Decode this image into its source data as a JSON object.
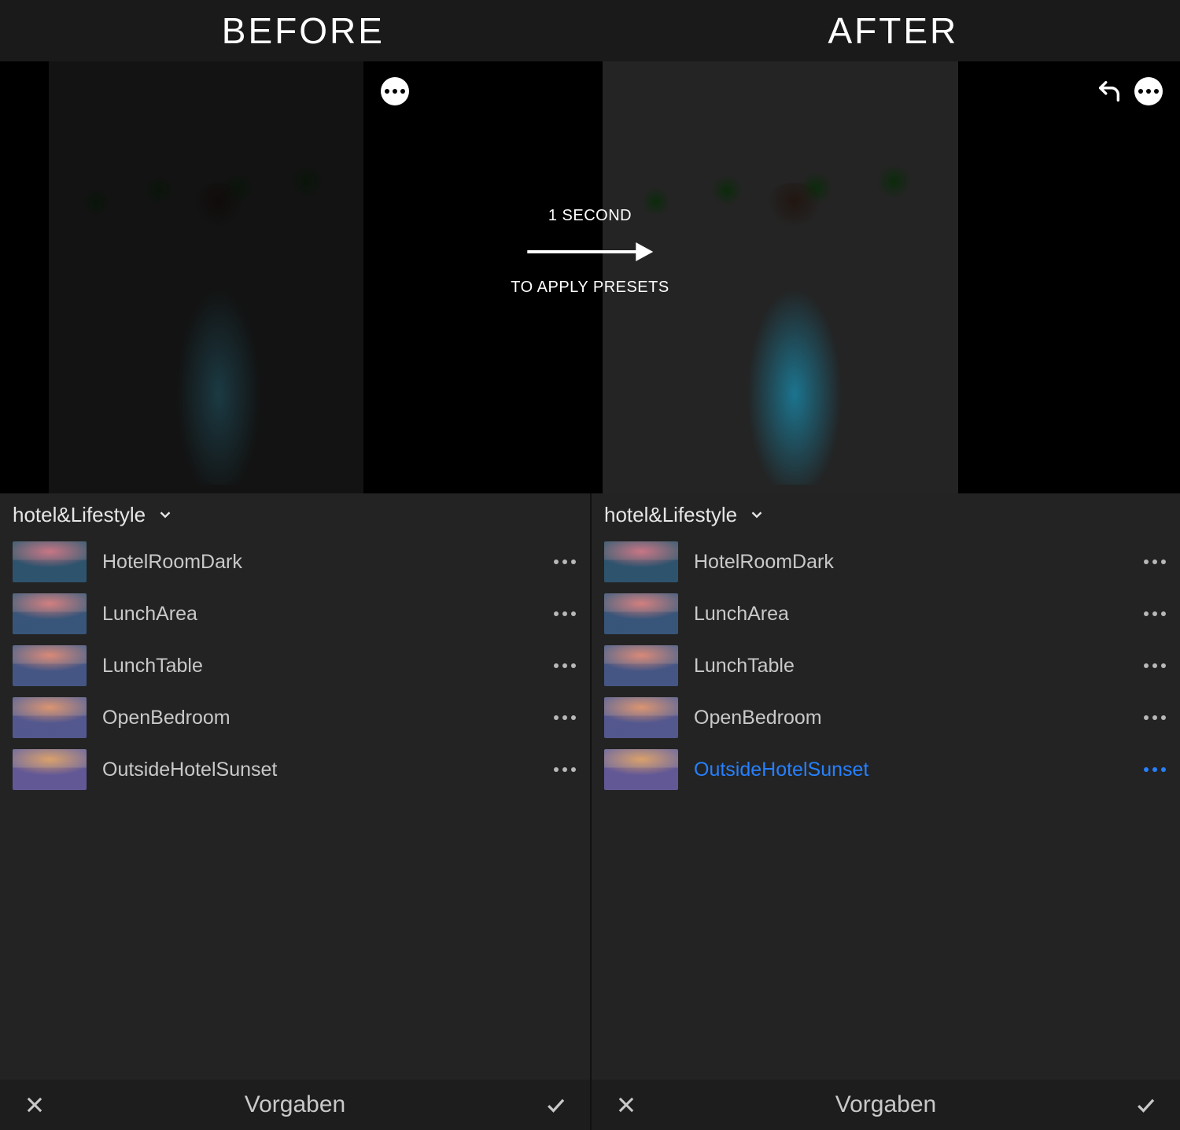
{
  "titlebar": {
    "before_label": "BEFORE",
    "after_label": "AFTER"
  },
  "divider": {
    "top": "1 SECOND",
    "bottom": "TO APPLY PRESETS"
  },
  "left": {
    "group": "hotel&Lifestyle",
    "footer_label": "Vorgaben",
    "presets": [
      {
        "name": "HotelRoomDark",
        "active": false
      },
      {
        "name": "LunchArea",
        "active": false
      },
      {
        "name": "LunchTable",
        "active": false
      },
      {
        "name": "OpenBedroom",
        "active": false
      },
      {
        "name": "OutsideHotelSunset",
        "active": false
      }
    ]
  },
  "right": {
    "group": "hotel&Lifestyle",
    "footer_label": "Vorgaben",
    "presets": [
      {
        "name": "HotelRoomDark",
        "active": false
      },
      {
        "name": "LunchArea",
        "active": false
      },
      {
        "name": "LunchTable",
        "active": false
      },
      {
        "name": "OpenBedroom",
        "active": false
      },
      {
        "name": "OutsideHotelSunset",
        "active": true
      }
    ]
  }
}
